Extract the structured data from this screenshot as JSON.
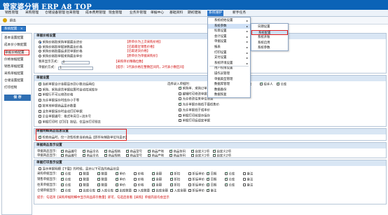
{
  "app": {
    "title": "管家婆分销 ERP A8 TOP"
  },
  "menubar": {
    "items": [
      "销售管理",
      "采购管理",
      "仓储设备管理",
      "往来管理",
      "成本费用管理",
      "现金管理",
      "业务外管理",
      "单据中心",
      "基础资料",
      "期初建账",
      "系统维护",
      "新手任务"
    ],
    "active_index": 10
  },
  "toolbar": {
    "exit_label": "退出"
  },
  "window_tab": {
    "label": "系统配置",
    "close": "×"
  },
  "left_panel": {
    "items": [
      "基本设置配置",
      "成本价小数配置",
      "单据价格配置",
      "价格依据配置",
      "销售单据配置",
      "采购单据配置",
      "仓储设置配置",
      "打印控制"
    ],
    "selected_index": 2,
    "save_label": "保 存"
  },
  "sections": {
    "price_setting": {
      "title": "单据价格设置",
      "rows": [
        {
          "label": "采购入库单",
          "mode": "采购价格取采购单据最近进价",
          "note": "【原单价为上次采购价格】"
        },
        {
          "label": "销售出库单",
          "mode": "采购价格取单据销售最近价格",
          "note": "【已取最近销售价格】"
        },
        {
          "label": "退货单据",
          "mode": "采购价格取最后退货单据价格",
          "note": "【已取退货价格】"
        },
        {
          "label": "调拨单据",
          "mode": "采购价格取单据采购最近单价",
          "note": "【原单价为单据采购价】"
        }
      ],
      "precision_label": "税率显示方式：",
      "precision_value": "0",
      "precision_note": "【采购单价精确位数】",
      "unit_label": "单据价方式：",
      "unit_value": "1",
      "unit_note": "【提示：1代表价格在整数区间内，2代表小数区间】"
    },
    "doc_setting": {
      "title": "单据设置",
      "left_items": [
        {
          "text": "当前单据合计金额显示到小数点后两位",
          "checked": true
        },
        {
          "text": "采购、采购退货单据结算时自动扣减库存",
          "checked": false
        },
        {
          "text": "单据行不可以修改价格",
          "checked": false
        },
        {
          "text": "允许单据保存时库存小于零",
          "checked": false
        },
        {
          "text": "按本地单据商品显示数量",
          "checked": false
        },
        {
          "text": "业务单据保存时自动打印单据",
          "checked": false
        },
        {
          "text": "企业单据编号：格式年月日+流水号",
          "checked": false
        },
        {
          "text": "单据打印时【打印】按钮，仅显示打印预览",
          "checked": false
        }
      ],
      "mid_label": "选择录入单据时：",
      "mid_items": [
        {
          "text": "采购单、采购订单显示已审核",
          "checked": true
        },
        {
          "text": "编辑时可修改单据内容",
          "checked": false
        },
        {
          "text": "允许修改往来单位信息",
          "checked": false
        },
        {
          "text": "允许单据价格低于最低售价",
          "checked": true
        },
        {
          "text": "允许单据低于成本价",
          "checked": false
        },
        {
          "text": "单据打印前提示保存",
          "checked": false
        },
        {
          "text": "单据打印后锁定单据",
          "checked": false
        }
      ],
      "right_items": [
        {
          "text": "结束",
          "checked": false
        },
        {
          "text": "经手人",
          "checked": true
        },
        {
          "text": "仓库",
          "checked": true
        }
      ]
    },
    "goods_setting": {
      "title": "单据明细商品信息设置",
      "item": "检索商品时，仅一次性检索当前商品【即所有辅助单位均显示】"
    },
    "column_setting": {
      "title": "单据商品显示设置",
      "row1_label": "单据商品显示：",
      "row2_label": "单据商品显示：",
      "cols": [
        "商品编号",
        "商品全名",
        "商品规格",
        "商品型号",
        "商品产地",
        "商品条码",
        "自定义1项",
        "自定义2项"
      ]
    },
    "bottom_setting": {
      "title": "单据打印显示设置",
      "intro": "显示单据明细【下载】的时候，显示以下可选的商品信息",
      "rows": [
        {
          "label": "采购单据显示：",
          "items": [
            "仓库",
            "数量",
            "数量",
            "单价",
            "价格",
            "金额",
            "折扣",
            "折后单价",
            "日期",
            "仓库",
            "备注"
          ]
        },
        {
          "label": "销售单据显示：",
          "items": [
            "仓库",
            "数量",
            "数量",
            "单价",
            "价格",
            "金额",
            "折扣",
            "折后单价",
            "日期",
            "仓库",
            "备注"
          ]
        },
        {
          "label": "往来单据显示：",
          "items": [
            "仓库",
            "数量",
            "数量",
            "单价",
            "价格",
            "金额",
            "折扣",
            "折后单价",
            "日期",
            "仓库",
            "备注"
          ]
        },
        {
          "label": "仓储单据显示：",
          "items": [
            "仓库",
            "出库仓库",
            "入库仓库",
            "出库数量",
            "入库数量",
            "出库金额",
            "入库金额",
            "折后单价",
            "备注"
          ]
        }
      ],
      "footer_note": "提示：勾选项【采购单据明细中显示商品库存数量】即可，勾选后查看【采购】单据内容均会显示"
    }
  },
  "dropdown_main": {
    "items": [
      "系统初始设置",
      "系统参数",
      "科目设置",
      "会计设置",
      "单据设置",
      "报表",
      "打印设置",
      "支付设置",
      "系统环境设置",
      "用户权限设置",
      "操作员管理",
      "单据类型管理",
      "数据库管理",
      "数据备份",
      "数据恢复"
    ],
    "hover_index": 1,
    "arrow_indices": [
      0,
      1,
      2,
      3,
      4,
      5,
      6,
      7,
      8
    ]
  },
  "dropdown_sub": {
    "items": [
      "日期设置",
      "系统配置",
      "系统开账",
      "系统启用",
      "系统参数"
    ],
    "selected_index": 1
  }
}
